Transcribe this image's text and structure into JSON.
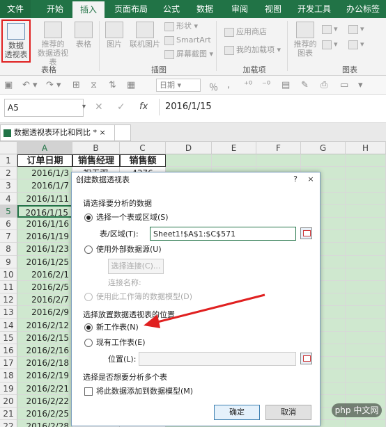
{
  "tabs": [
    "文件",
    "开始",
    "插入",
    "页面布局",
    "公式",
    "数据",
    "审阅",
    "视图",
    "开发工具",
    "办公标签"
  ],
  "active_tab": "插入",
  "ribbon": {
    "pivot_l1": "数据",
    "pivot_l2": "透视表",
    "rec_pivot_l1": "推荐的",
    "rec_pivot_l2": "数据透视表",
    "table": "表格",
    "picture": "图片",
    "online_pic": "联机图片",
    "shapes": "形状",
    "smartart": "SmartArt",
    "screenshot": "屏幕截图",
    "store": "应用商店",
    "my_addins": "我的加载项",
    "rec_chart_l1": "推荐的",
    "rec_chart_l2": "图表",
    "groups": {
      "tables": "表格",
      "illustrations": "插图",
      "addins": "加载项",
      "charts": "图表"
    }
  },
  "qat": {
    "format": "日期"
  },
  "formula_bar": {
    "name_box": "A5",
    "fx": "fx",
    "value": "2016/1/15"
  },
  "workbook": {
    "tab": "数据透视表环比和同比 *"
  },
  "columns": [
    "A",
    "B",
    "C",
    "D",
    "E",
    "F",
    "G",
    "H"
  ],
  "rows": [
    "1",
    "2",
    "3",
    "4",
    "5",
    "6",
    "7",
    "8",
    "9",
    "10",
    "11",
    "12",
    "13",
    "14",
    "15",
    "16",
    "17",
    "18",
    "19",
    "20",
    "21",
    "22"
  ],
  "headers": {
    "a": "订单日期",
    "b": "销售经理",
    "c": "销售额"
  },
  "row2": {
    "b": "祝无双",
    "c": "4376"
  },
  "dates": [
    "2016/1/3",
    "2016/1/7",
    "2016/1/11",
    "2016/1/15",
    "2016/1/16",
    "2016/1/19",
    "2016/1/23",
    "2016/1/25",
    "2016/2/1",
    "2016/2/5",
    "2016/2/7",
    "2016/2/9",
    "2016/2/12",
    "2016/2/15",
    "2016/2/16",
    "2016/2/18",
    "2016/2/19",
    "2016/2/21",
    "2016/2/22",
    "2016/2/25",
    "2016/2/28"
  ],
  "dialog": {
    "title": "创建数据透视表",
    "help": "?",
    "close": "×",
    "section1": "请选择要分析的数据",
    "opt_select_range": "选择一个表或区域(S)",
    "range_label": "表/区域(T):",
    "range_value": "Sheet1!$A$1:$C$571",
    "opt_external": "使用外部数据源(U)",
    "choose_conn": "选择连接(C)...",
    "conn_name": "连接名称:",
    "opt_data_model": "使用此工作簿的数据模型(D)",
    "section2": "选择放置数据透视表的位置",
    "opt_new_sheet": "新工作表(N)",
    "opt_existing": "现有工作表(E)",
    "location_label": "位置(L):",
    "section3": "选择是否想要分析多个表",
    "add_to_model": "将此数据添加到数据模型(M)",
    "ok": "确定",
    "cancel": "取消"
  },
  "watermark": "php 中文网",
  "colors": {
    "excel_green": "#217346",
    "selection_fill": "#cfe8cf",
    "arrow": "#e02020"
  }
}
